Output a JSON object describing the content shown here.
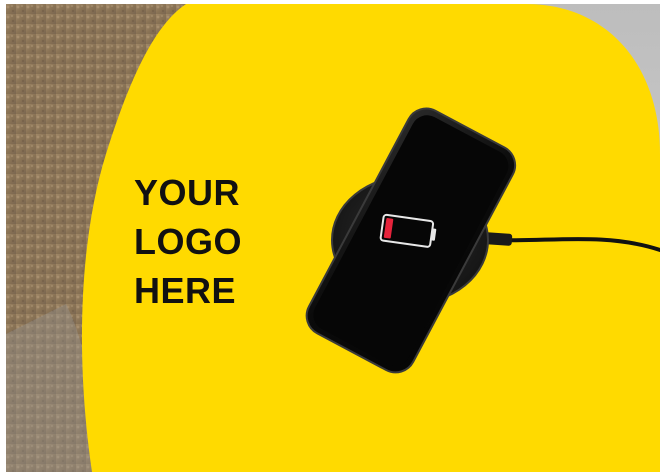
{
  "logo": {
    "line1": "YOUR",
    "line2": "LOGO",
    "line3": "HERE"
  },
  "colors": {
    "accent_yellow": "#FFDA00",
    "phone_body": "#0a0a0a",
    "battery_low": "#e5233b",
    "carpet": "#8a7355"
  },
  "icons": {
    "battery": "battery-low-icon",
    "charger": "wireless-charger-pad"
  }
}
